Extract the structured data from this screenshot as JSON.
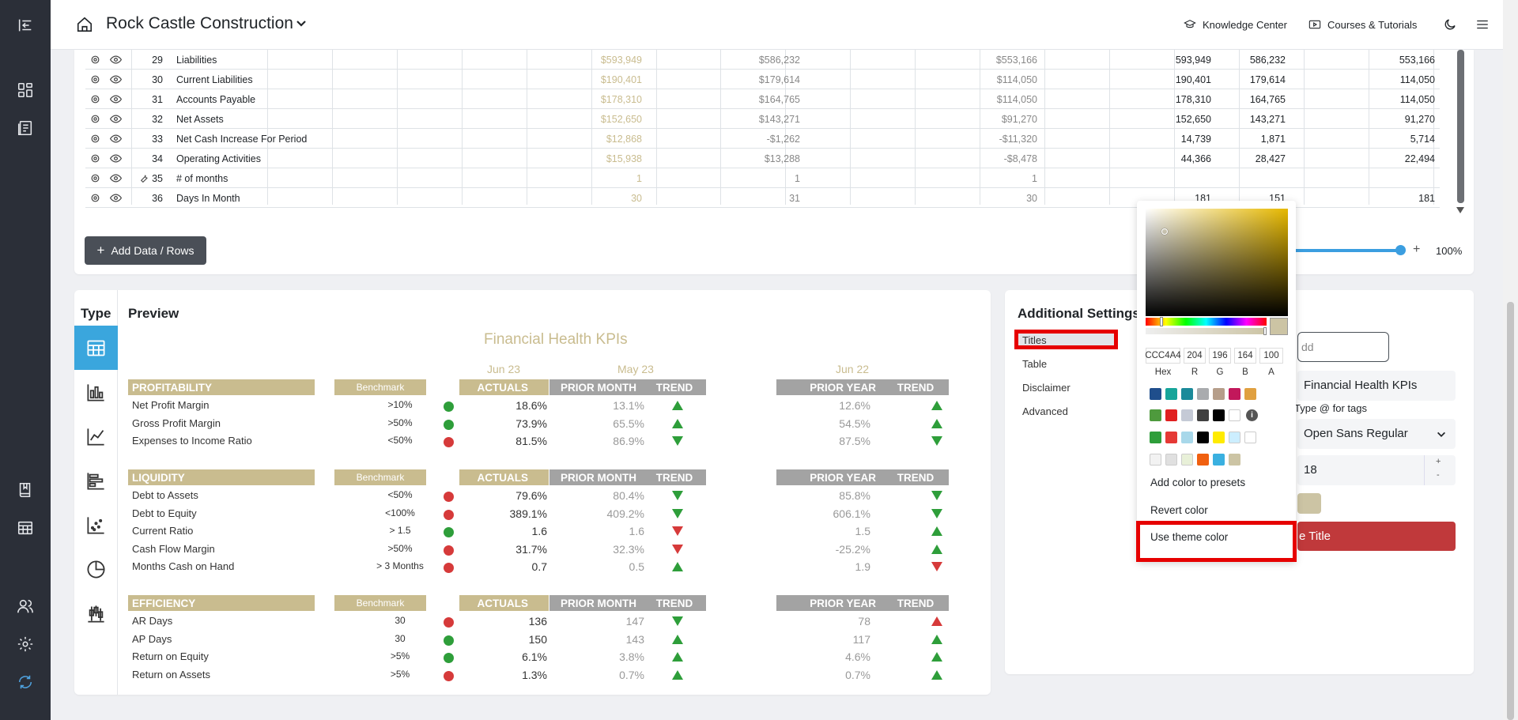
{
  "app": {
    "company": "Rock Castle Construction"
  },
  "topbar": {
    "knowledge_center": "Knowledge Center",
    "courses": "Courses & Tutorials"
  },
  "table_rows": [
    {
      "num": "29",
      "label": "Liabilities",
      "a": "$593,949",
      "b": "$586,232",
      "c": "$553,166",
      "d": "593,949",
      "e": "586,232",
      "f": "553,166",
      "wrench": false
    },
    {
      "num": "30",
      "label": "Current Liabilities",
      "a": "$190,401",
      "b": "$179,614",
      "c": "$114,050",
      "d": "190,401",
      "e": "179,614",
      "f": "114,050",
      "wrench": false
    },
    {
      "num": "31",
      "label": "Accounts Payable",
      "a": "$178,310",
      "b": "$164,765",
      "c": "$114,050",
      "d": "178,310",
      "e": "164,765",
      "f": "114,050",
      "wrench": false
    },
    {
      "num": "32",
      "label": "Net Assets",
      "a": "$152,650",
      "b": "$143,271",
      "c": "$91,270",
      "d": "152,650",
      "e": "143,271",
      "f": "91,270",
      "wrench": false
    },
    {
      "num": "33",
      "label": "Net Cash Increase For Period",
      "a": "$12,868",
      "b": "-$1,262",
      "c": "-$11,320",
      "d": "14,739",
      "e": "1,871",
      "f": "5,714",
      "wrench": false
    },
    {
      "num": "34",
      "label": "Operating Activities",
      "a": "$15,938",
      "b": "$13,288",
      "c": "-$8,478",
      "d": "44,366",
      "e": "28,427",
      "f": "22,494",
      "wrench": false
    },
    {
      "num": "35",
      "label": "# of months",
      "a": "1",
      "b": "1",
      "c": "1",
      "d": "",
      "e": "",
      "f": "",
      "wrench": true
    },
    {
      "num": "36",
      "label": "Days In Month",
      "a": "30",
      "b": "31",
      "c": "30",
      "d": "181",
      "e": "151",
      "f": "181",
      "wrench": false
    }
  ],
  "table_controls": {
    "add_rows": "Add Data / Rows",
    "zoom": "100%",
    "zoom_plus": "+"
  },
  "preview": {
    "type_title": "Type",
    "title": "Preview",
    "kpi_title": "Financial Health KPIs",
    "dates": [
      "Jun 23",
      "May 23",
      "Jun 22"
    ],
    "headers": {
      "benchmark": "Benchmark",
      "actuals": "ACTUALS",
      "prior_month": "PRIOR MONTH",
      "prior_year": "PRIOR YEAR",
      "trend": "TREND"
    },
    "sections": [
      {
        "name": "PROFITABILITY",
        "rows": [
          {
            "kpi": "Net Profit Margin",
            "bench": ">10%",
            "status": "green",
            "act": "18.6%",
            "pm": "13.1%",
            "pm_trend": "up-green",
            "py": "12.6%",
            "py_trend": "up-green"
          },
          {
            "kpi": "Gross Profit Margin",
            "bench": ">50%",
            "status": "green",
            "act": "73.9%",
            "pm": "65.5%",
            "pm_trend": "up-green",
            "py": "54.5%",
            "py_trend": "up-green"
          },
          {
            "kpi": "Expenses to Income Ratio",
            "bench": "<50%",
            "status": "red",
            "act": "81.5%",
            "pm": "86.9%",
            "pm_trend": "down-green",
            "py": "87.5%",
            "py_trend": "down-green"
          }
        ]
      },
      {
        "name": "LIQUIDITY",
        "rows": [
          {
            "kpi": "Debt to Assets",
            "bench": "<50%",
            "status": "red",
            "act": "79.6%",
            "pm": "80.4%",
            "pm_trend": "down-green",
            "py": "85.8%",
            "py_trend": "down-green"
          },
          {
            "kpi": "Debt to Equity",
            "bench": "<100%",
            "status": "red",
            "act": "389.1%",
            "pm": "409.2%",
            "pm_trend": "down-green",
            "py": "606.1%",
            "py_trend": "down-green"
          },
          {
            "kpi": "Current Ratio",
            "bench": "> 1.5",
            "status": "green",
            "act": "1.6",
            "pm": "1.6",
            "pm_trend": "down-red",
            "py": "1.5",
            "py_trend": "up-green"
          },
          {
            "kpi": "Cash Flow Margin",
            "bench": ">50%",
            "status": "red",
            "act": "31.7%",
            "pm": "32.3%",
            "pm_trend": "down-red",
            "py": "-25.2%",
            "py_trend": "up-green"
          },
          {
            "kpi": "Months Cash on Hand",
            "bench": "> 3 Months",
            "status": "red",
            "act": "0.7",
            "pm": "0.5",
            "pm_trend": "up-green",
            "py": "1.9",
            "py_trend": "down-red"
          }
        ]
      },
      {
        "name": "EFFICIENCY",
        "rows": [
          {
            "kpi": "AR Days",
            "bench": "30",
            "status": "red",
            "act": "136",
            "pm": "147",
            "pm_trend": "down-green",
            "py": "78",
            "py_trend": "up-red"
          },
          {
            "kpi": "AP Days",
            "bench": "30",
            "status": "green",
            "act": "150",
            "pm": "143",
            "pm_trend": "up-green",
            "py": "117",
            "py_trend": "up-green"
          },
          {
            "kpi": "Return on Equity",
            "bench": ">5%",
            "status": "green",
            "act": "6.1%",
            "pm": "3.8%",
            "pm_trend": "up-green",
            "py": "4.6%",
            "py_trend": "up-green"
          },
          {
            "kpi": "Return on Assets",
            "bench": ">5%",
            "status": "red",
            "act": "1.3%",
            "pm": "0.7%",
            "pm_trend": "up-green",
            "py": "0.7%",
            "py_trend": "up-green"
          }
        ]
      }
    ]
  },
  "settings": {
    "title": "Additional Settings",
    "tabs": [
      "Titles",
      "Table",
      "Disclaimer",
      "Advanced"
    ],
    "add_label": "dd",
    "title_value": "Financial Health KPIs",
    "hint": "Type @ for tags",
    "font": "Open Sans Regular",
    "size": "18",
    "size_plus": "+",
    "size_minus": "-",
    "title_color": "#ccc4a4",
    "title_button": "e Title"
  },
  "picker": {
    "hex": "CCC4A4",
    "r": "204",
    "g": "196",
    "b": "164",
    "a": "100",
    "labels": {
      "hex": "Hex",
      "r": "R",
      "g": "G",
      "b": "B",
      "a": "A"
    },
    "presets": [
      [
        "#1f4e8c",
        "#16a59a",
        "#1b8a9a",
        "#a9abae",
        "#b69e8a",
        "#c2185b",
        "#e0a040"
      ],
      [
        "#4e9a3d",
        "#e02020",
        "#c5cad6",
        "#404040",
        "#000000",
        "#ffffff",
        "info"
      ],
      [
        "#2e9e3a",
        "#e53935",
        "#a8d8ea",
        "#000000",
        "#ffeb00",
        "#cceeff",
        "#ffffff"
      ],
      [
        "#f2f2f2",
        "#e0e0e0",
        "#e8f0d8",
        "#f06010",
        "#3ab0e0",
        "#ccc4a4",
        ""
      ]
    ],
    "add_preset": "Add color to presets",
    "revert": "Revert color",
    "use_theme": "Use theme color"
  },
  "colors": {
    "accent": "#3aa6dd",
    "gold": "#c9bc8f",
    "red": "#c0393b",
    "highlight": "#e60000"
  }
}
